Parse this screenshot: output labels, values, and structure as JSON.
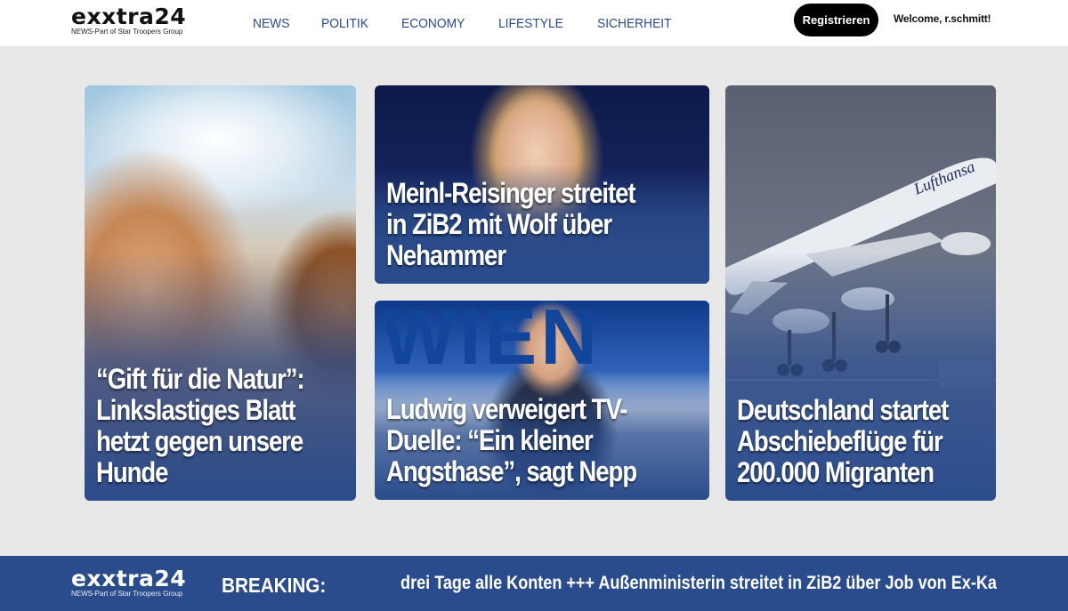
{
  "header": {
    "logo_main": "exxtra24",
    "logo_sub": "NEWS-Part of Star Troopers Group",
    "nav": [
      "NEWS",
      "POLITIK",
      "ECONOMY",
      "LIFESTYLE",
      "SICHERHEIT"
    ],
    "register_label": "Registrieren",
    "welcome": "Welcome, r.schmitt!"
  },
  "cards": {
    "dog": {
      "title": "“Gift für die Natur”: Linkslastiges Blatt hetzt gegen unsere Hunde"
    },
    "meinl": {
      "title": "Meinl-Reisinger streitet in ZiB2 mit Wolf über Nehammer"
    },
    "ludwig": {
      "title": "Ludwig verweigert TV-Duelle: “Ein kleiner Angsthase”, sagt Nepp",
      "backdrop_text": "WIEN"
    },
    "plane": {
      "title": "Deutschland startet Abschiebeflüge für 200.000 Migranten",
      "livery_text": "Lufthansa"
    }
  },
  "ticker": {
    "logo_main": "exxtra24",
    "logo_sub": "NEWS-Part of Star Troopers Group",
    "label": "BREAKING:",
    "text": "drei Tage alle Konten +++ Außenministerin streitet in ZiB2 über Job von Ex-Ka"
  },
  "colors": {
    "brand_blue": "#2b4c8c",
    "nav_text": "#2a4a8a",
    "background": "#e8e8e8",
    "button": "#000000"
  }
}
